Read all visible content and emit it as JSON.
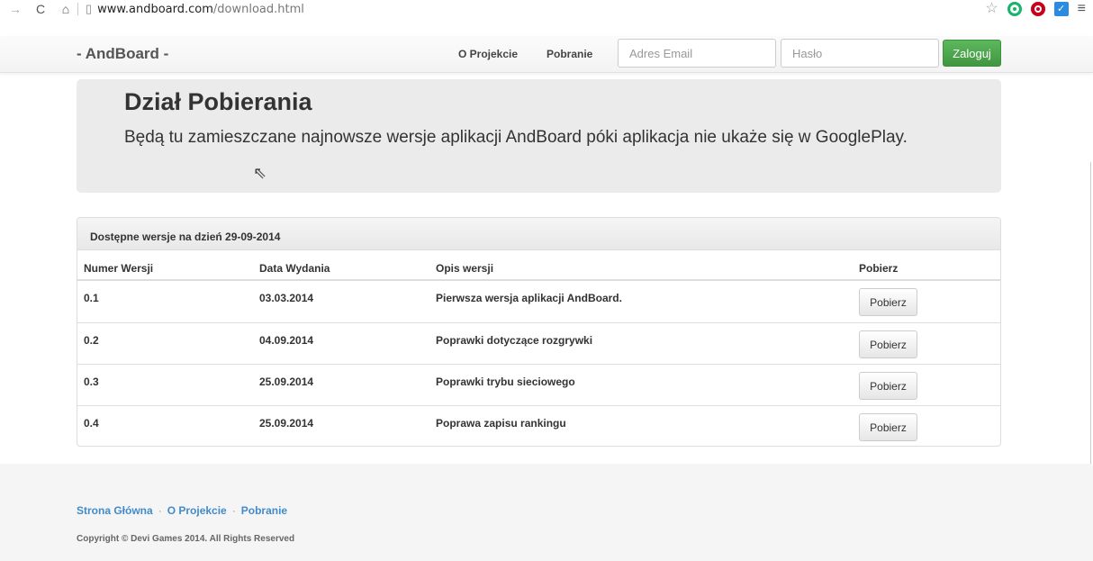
{
  "browser": {
    "url_host": "www.andboard.com",
    "url_path": "/download.html"
  },
  "navbar": {
    "brand": "- AndBoard -",
    "links": [
      "O Projekcie",
      "Pobranie"
    ],
    "email_placeholder": "Adres Email",
    "password_placeholder": "Hasło",
    "login_label": "Zaloguj"
  },
  "jumbotron": {
    "title": "Dział Pobierania",
    "text": "Będą tu zamieszczane najnowsze wersje aplikacji AndBoard póki aplikacja nie ukaże się w GooglePlay."
  },
  "panel": {
    "heading": "Dostępne wersje na dzień 29-09-2014",
    "columns": [
      "Numer Wersji",
      "Data Wydania",
      "Opis wersji",
      "Pobierz"
    ],
    "rows": [
      {
        "version": "0.1",
        "date": "03.03.2014",
        "desc": "Pierwsza wersja aplikacji AndBoard.",
        "button": "Pobierz"
      },
      {
        "version": "0.2",
        "date": "04.09.2014",
        "desc": "Poprawki dotyczące rozgrywki",
        "button": "Pobierz"
      },
      {
        "version": "0.3",
        "date": "25.09.2014",
        "desc": "Poprawki trybu sieciowego",
        "button": "Pobierz"
      },
      {
        "version": "0.4",
        "date": "25.09.2014",
        "desc": "Poprawa zapisu rankingu",
        "button": "Pobierz"
      }
    ]
  },
  "footer": {
    "links": [
      "Strona Główna",
      "O Projekcie",
      "Pobranie"
    ],
    "separator": "·",
    "copyright": "Copyright © Devi Games 2014. All Rights Reserved"
  },
  "colors": {
    "accent_link": "#428bca",
    "login_button": "#5cb85c"
  }
}
